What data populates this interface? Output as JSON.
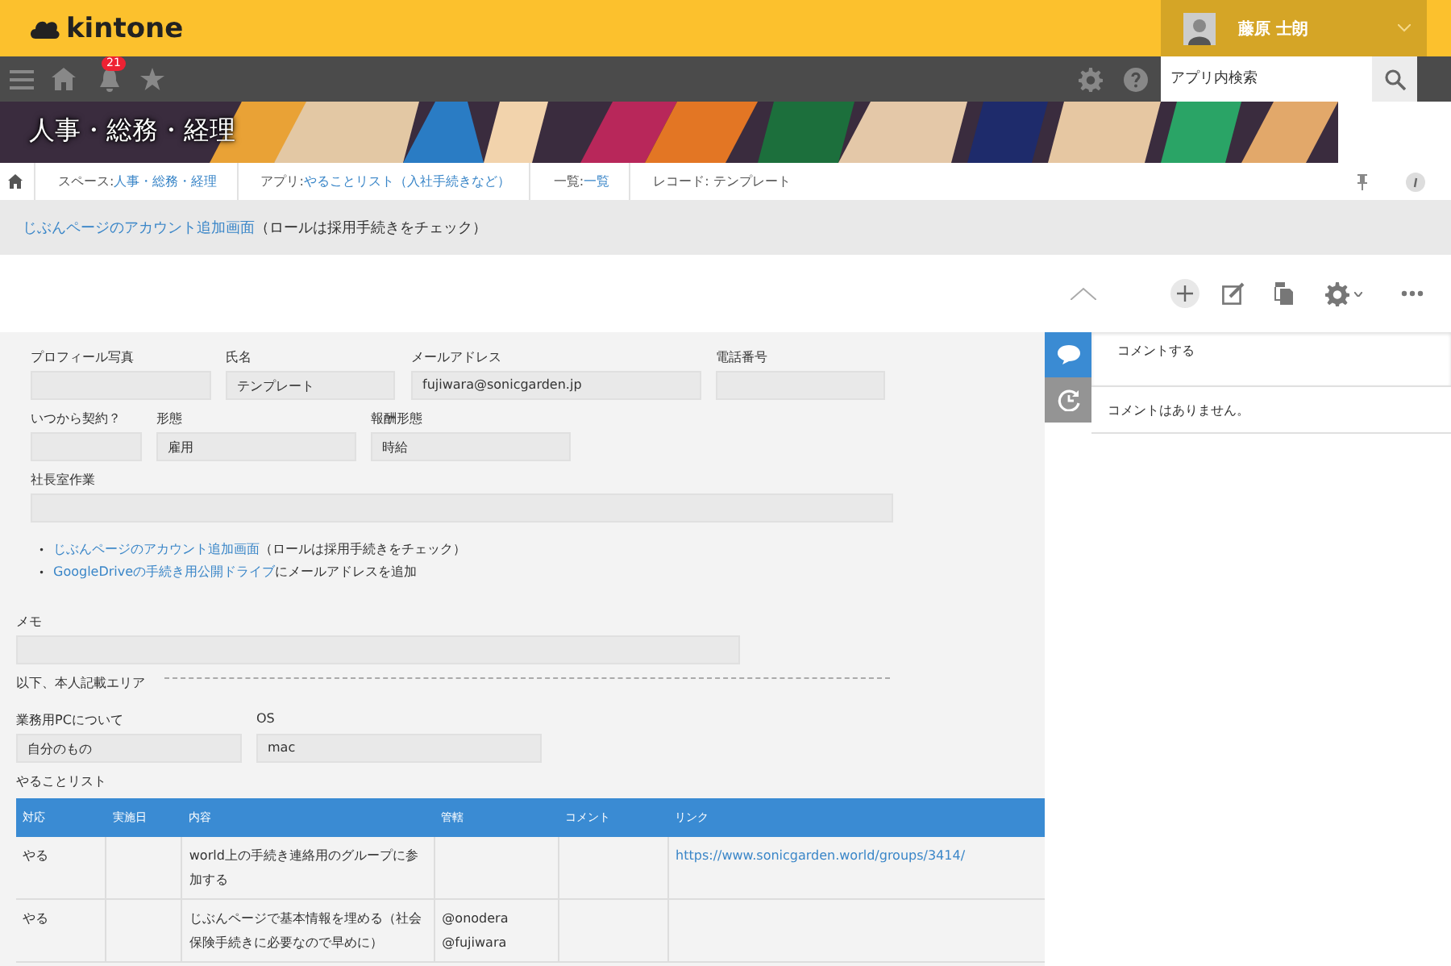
{
  "header": {
    "logo": "kintone",
    "user": {
      "name": "藤原 士朗"
    }
  },
  "nav": {
    "notification_count": "21",
    "search": {
      "placeholder": "アプリ内検索"
    }
  },
  "banner": {
    "title": "人事・総務・経理"
  },
  "breadcrumbs": [
    {
      "label": "スペース: ",
      "link": "人事・総務・経理"
    },
    {
      "label": "アプリ: ",
      "link": "やることリスト（入社手続きなど）"
    },
    {
      "label": "一覧: ",
      "link": "一覧"
    },
    {
      "label": "レコード: テンプレート"
    }
  ],
  "record_title": {
    "link": "じぶんページのアカウント追加画面",
    "text": "（ロールは採用手続きをチェック）"
  },
  "form": {
    "rows": [
      [
        {
          "label": "プロフィール写真"
        },
        {
          "label": "氏名",
          "value": "テンプレート"
        },
        {
          "label": "メールアドレス",
          "value": "fujiwara@sonicgarden.jp"
        },
        {
          "label": "電話番号"
        }
      ],
      [
        {
          "label": "いつから契約？"
        },
        {
          "label": "形態",
          "value": "雇用"
        },
        {
          "label": "報酬形態",
          "value": "時給"
        }
      ],
      [
        {
          "label": "社長室作業"
        }
      ]
    ],
    "notes": [
      {
        "bullet": "•",
        "link": "じぶんページのアカウント追加画面",
        "text": "（ロールは採用手続きをチェック）"
      },
      {
        "bullet": "•",
        "link": "GoogleDriveの手続き用公開ドライブ",
        "text": "にメールアドレスを追加"
      }
    ],
    "memo": {
      "label": "メモ"
    },
    "section_label": "以下、本人記載エリア",
    "pc_row": [
      {
        "label": "業務用PCについて",
        "value": "自分のもの"
      },
      {
        "label": "OS",
        "value": "mac"
      }
    ],
    "table": {
      "title": "やることリスト",
      "columns": [
        "対応",
        "実施日",
        "内容",
        "管轄",
        "コメント",
        "リンク"
      ],
      "rows": [
        [
          "やる",
          "",
          "world上の手続き連絡用のグループに参加する",
          "",
          "",
          "https://www.sonicgarden.world/groups/3414/"
        ],
        [
          "やる",
          "",
          "じぶんページで基本情報を埋める（社会保険手続きに必要なので早めに）",
          "@onodera\n@fujiwara",
          "",
          ""
        ]
      ]
    }
  },
  "side_tabs": [
    {
      "kind": "comments",
      "selected": true
    },
    {
      "kind": "history",
      "selected": false
    }
  ],
  "comments": {
    "placeholder": "コメントする",
    "empty_message": "コメントはありません。"
  }
}
